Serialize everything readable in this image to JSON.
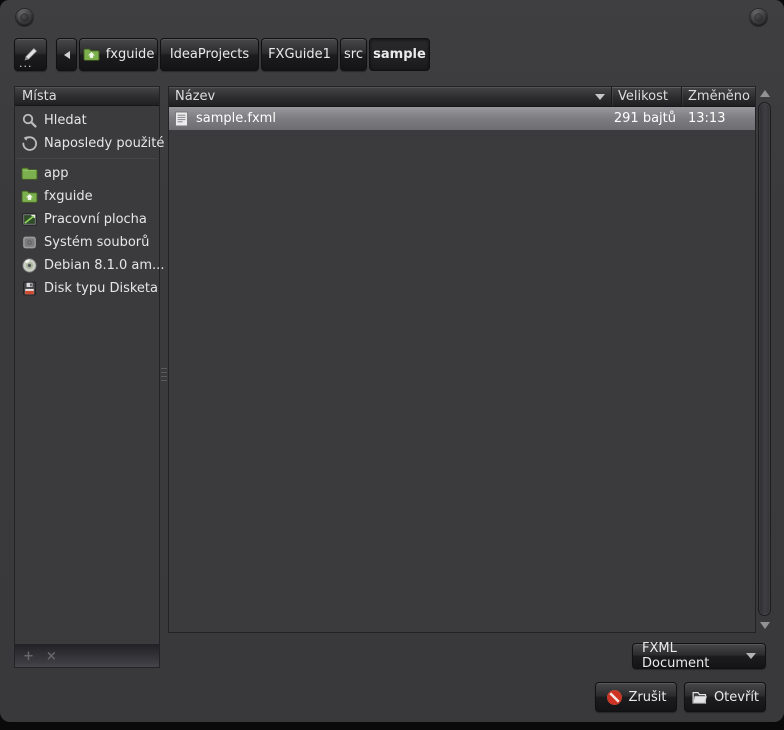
{
  "toolbar": {
    "location_ellipsis": "...",
    "breadcrumbs": [
      {
        "label": "fxguide"
      },
      {
        "label": "IdeaProjects"
      },
      {
        "label": "FXGuide1"
      },
      {
        "label": "src"
      },
      {
        "label": "sample"
      }
    ]
  },
  "sidebar": {
    "title": "Místa",
    "items": [
      {
        "label": "Hledat",
        "icon": "search-icon"
      },
      {
        "label": "Naposledy použité",
        "icon": "recent-icon"
      },
      {
        "label": "app",
        "icon": "folder-icon"
      },
      {
        "label": "fxguide",
        "icon": "home-folder-icon"
      },
      {
        "label": "Pracovní plocha",
        "icon": "desktop-icon"
      },
      {
        "label": "Systém souborů",
        "icon": "filesystem-icon"
      },
      {
        "label": "Debian 8.1.0 am...",
        "icon": "optical-disc-icon"
      },
      {
        "label": "Disk typu Disketa",
        "icon": "floppy-icon"
      }
    ],
    "add_bookmark_label": "+",
    "remove_bookmark_label": "×"
  },
  "file_list": {
    "columns": {
      "name": "Název",
      "size": "Velikost",
      "modified": "Změněno"
    },
    "rows": [
      {
        "name": "sample.fxml",
        "size": "291 bajtů",
        "modified": "13:13"
      }
    ]
  },
  "footer": {
    "file_type_value": "FXML Document",
    "cancel_label": "Zrušit",
    "open_label": "Otevřít"
  },
  "colors": {
    "folder_green": "#7cb04e",
    "cancel_red": "#cf3322",
    "selection_grey": "#85858a",
    "window_bg": "#3a3a3c"
  }
}
